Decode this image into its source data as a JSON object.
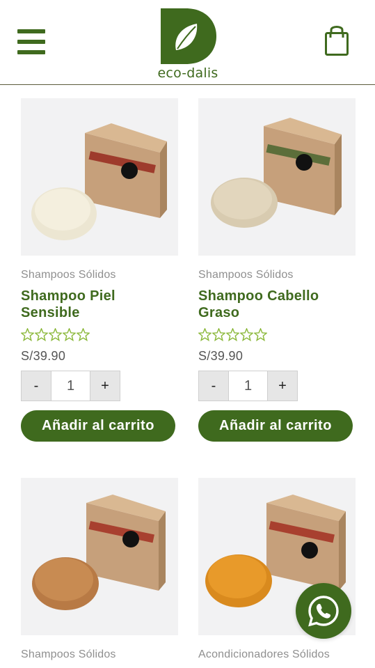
{
  "header": {
    "logo_text": "eco-dalis",
    "menu_icon": "hamburger-menu-icon",
    "cart_icon": "shopping-bag-icon"
  },
  "colors": {
    "brand_green": "#3f6a1e",
    "star_green": "#8bb83a",
    "image_bg": "#f2f2f3"
  },
  "products": [
    {
      "category": "Shampoos Sólidos",
      "title": "Shampoo Piel Sensible",
      "rating": 0,
      "max_rating": 5,
      "price": "S/39.90",
      "quantity": "1",
      "minus_label": "-",
      "plus_label": "+",
      "add_to_cart": "Añadir al carrito"
    },
    {
      "category": "Shampoos Sólidos",
      "title": "Shampoo Cabello Graso",
      "rating": 0,
      "max_rating": 5,
      "price": "S/39.90",
      "quantity": "1",
      "minus_label": "-",
      "plus_label": "+",
      "add_to_cart": "Añadir al carrito"
    },
    {
      "category": "Shampoos Sólidos"
    },
    {
      "category": "Acondicionadores Sólidos"
    }
  ],
  "floating": {
    "whatsapp_icon": "whatsapp-icon"
  }
}
